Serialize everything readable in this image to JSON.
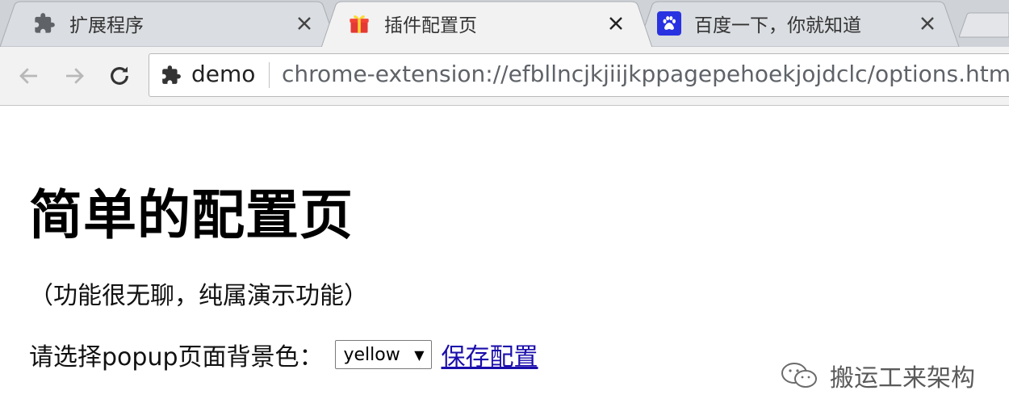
{
  "tabs": [
    {
      "title": "扩展程序",
      "icon": "puzzle-icon",
      "active": false
    },
    {
      "title": "插件配置页",
      "icon": "gift-icon",
      "active": true
    },
    {
      "title": "百度一下，你就知道",
      "icon": "baidu-paw-icon",
      "active": false
    }
  ],
  "toolbar": {
    "chip_label": "demo",
    "url": "chrome-extension://efbllncjkjiijkppagepehoekjojdclc/options.html"
  },
  "page": {
    "heading": "简单的配置页",
    "description": "（功能很无聊，纯属演示功能）",
    "bg_label": "请选择popup页面背景色：",
    "bg_selected": "yellow",
    "save_link": "保存配置"
  },
  "watermark": {
    "text": "搬运工来架构"
  },
  "colors": {
    "tabstrip": "#cfd3d8",
    "active_tab": "#f2f2f2",
    "link": "#1a0dab"
  }
}
